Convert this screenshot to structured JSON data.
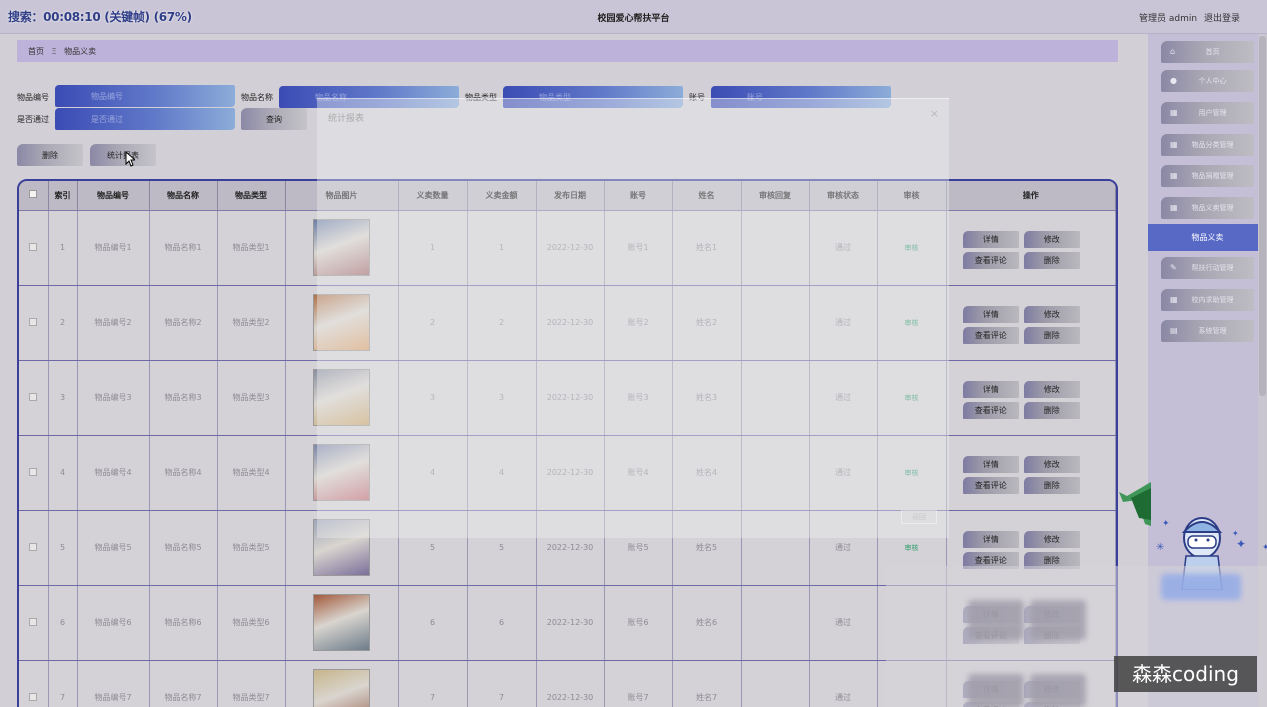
{
  "header": {
    "timer": "搜索：00:08:10 (关键帧) (67%)",
    "title": "校园爱心帮扶平台",
    "user_role": "管理员 admin",
    "logout": "退出登录"
  },
  "breadcrumb": {
    "home": "首页",
    "separator": "Ξ",
    "current": "物品义卖"
  },
  "search": {
    "fields": [
      {
        "label": "物品编号",
        "placeholder": "物品编号"
      },
      {
        "label": "物品名称",
        "placeholder": "物品名称"
      },
      {
        "label": "物品类型",
        "placeholder": "物品类型"
      },
      {
        "label": "账号",
        "placeholder": "账号"
      },
      {
        "label": "是否通过",
        "placeholder": "是否通过"
      }
    ],
    "query_label": "查询",
    "delete_label": "删除",
    "stats_label": "统计报表"
  },
  "table": {
    "columns": [
      "索引",
      "物品编号",
      "物品名称",
      "物品类型",
      "物品图片",
      "义卖数量",
      "义卖金额",
      "发布日期",
      "账号",
      "姓名",
      "审核回复",
      "审核状态",
      "审核",
      "操作"
    ],
    "rows": [
      {
        "index": "1",
        "code": "物品编号1",
        "name": "物品名称1",
        "type": "物品类型1",
        "qty": "1",
        "amount": "1",
        "date": "2022-12-30",
        "account": "账号1",
        "person": "姓名1",
        "reply": "",
        "status": "通过",
        "audit": "审核"
      },
      {
        "index": "2",
        "code": "物品编号2",
        "name": "物品名称2",
        "type": "物品类型2",
        "qty": "2",
        "amount": "2",
        "date": "2022-12-30",
        "account": "账号2",
        "person": "姓名2",
        "reply": "",
        "status": "通过",
        "audit": "审核"
      },
      {
        "index": "3",
        "code": "物品编号3",
        "name": "物品名称3",
        "type": "物品类型3",
        "qty": "3",
        "amount": "3",
        "date": "2022-12-30",
        "account": "账号3",
        "person": "姓名3",
        "reply": "",
        "status": "通过",
        "audit": "审核"
      },
      {
        "index": "4",
        "code": "物品编号4",
        "name": "物品名称4",
        "type": "物品类型4",
        "qty": "4",
        "amount": "4",
        "date": "2022-12-30",
        "account": "账号4",
        "person": "姓名4",
        "reply": "",
        "status": "通过",
        "audit": "审核"
      },
      {
        "index": "5",
        "code": "物品编号5",
        "name": "物品名称5",
        "type": "物品类型5",
        "qty": "5",
        "amount": "5",
        "date": "2022-12-30",
        "account": "账号5",
        "person": "姓名5",
        "reply": "",
        "status": "通过",
        "audit": "审核"
      },
      {
        "index": "6",
        "code": "物品编号6",
        "name": "物品名称6",
        "type": "物品类型6",
        "qty": "6",
        "amount": "6",
        "date": "2022-12-30",
        "account": "账号6",
        "person": "姓名6",
        "reply": "",
        "status": "通过",
        "audit": ""
      },
      {
        "index": "7",
        "code": "物品编号7",
        "name": "物品名称7",
        "type": "物品类型7",
        "qty": "7",
        "amount": "7",
        "date": "2022-12-30",
        "account": "账号7",
        "person": "姓名7",
        "reply": "",
        "status": "通过",
        "audit": ""
      }
    ],
    "actions": {
      "detail": "详情",
      "edit": "修改",
      "comments": "查看评论",
      "delete": "删除"
    }
  },
  "stats_panel": {
    "title": "统计报表",
    "close": "×",
    "button": "返回"
  },
  "sidebar": {
    "items": [
      {
        "label": "首页",
        "icon": "home-icon"
      },
      {
        "label": "个人中心",
        "icon": "user-icon"
      },
      {
        "label": "用户管理",
        "icon": "grid-icon"
      },
      {
        "label": "物品分类管理",
        "icon": "grid-icon"
      },
      {
        "label": "物品捐赠管理",
        "icon": "grid-icon"
      },
      {
        "label": "物品义卖管理",
        "icon": "grid-icon"
      },
      {
        "label": "帮扶行动管理",
        "icon": "pencil-icon"
      },
      {
        "label": "校内求助管理",
        "icon": "grid-icon"
      },
      {
        "label": "系统管理",
        "icon": "doc-icon"
      }
    ],
    "active": "物品义卖"
  },
  "watermark": "森森coding",
  "colors": {
    "accent": "#5769c5",
    "input_gradient_start": "#3b4bb4",
    "header_bg": "#c9c5d6",
    "audit_green": "#2e9d6d"
  }
}
